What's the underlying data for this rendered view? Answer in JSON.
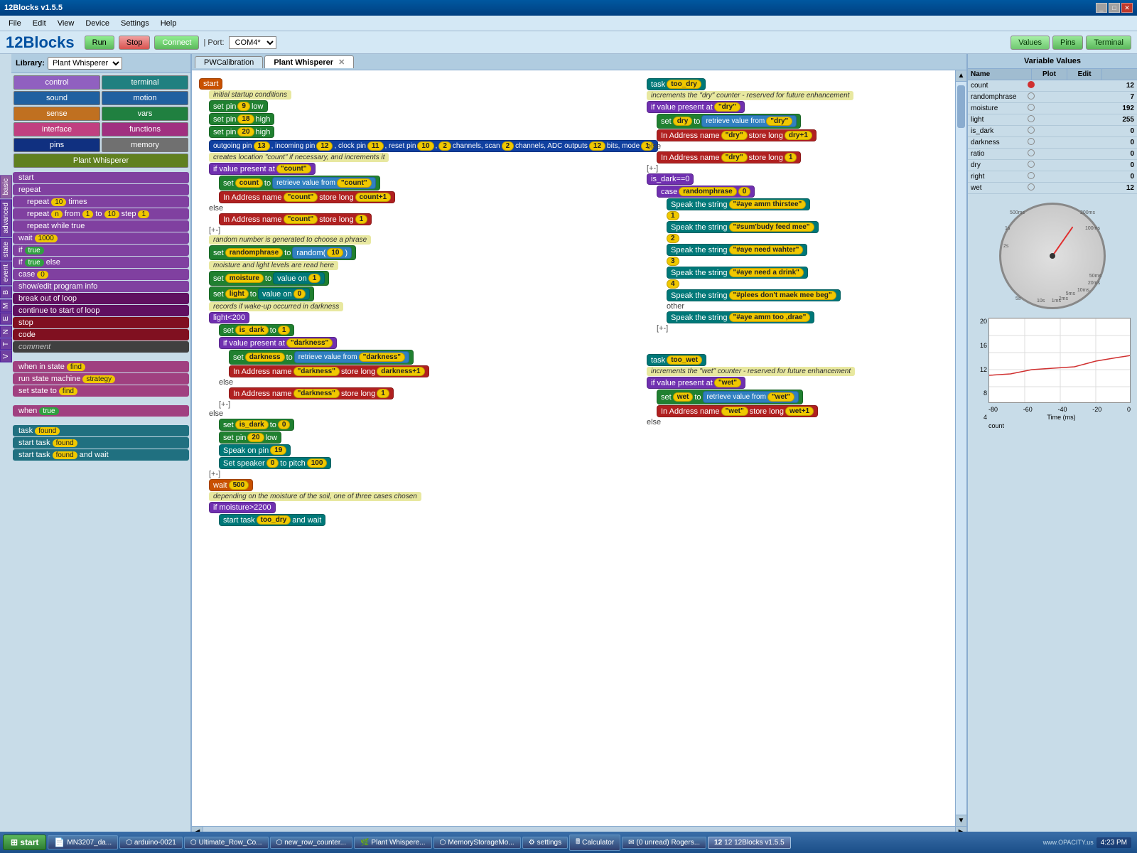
{
  "window": {
    "title": "12Blocks v1.5.5",
    "titlebar_icon": "12"
  },
  "menubar": {
    "items": [
      "File",
      "Edit",
      "View",
      "Device",
      "Settings",
      "Help"
    ]
  },
  "toolbar": {
    "app_title": "12Blocks",
    "run_label": "Run",
    "stop_label": "Stop",
    "connect_label": "Connect",
    "port_label": "| Port:",
    "port_value": "COM4*",
    "right_tabs": [
      "Values",
      "Pins",
      "Terminal"
    ]
  },
  "library": {
    "label": "Library:",
    "selected": "Plant Whisperer",
    "categories": [
      {
        "label": "control",
        "style": "purple"
      },
      {
        "label": "terminal",
        "style": "teal"
      },
      {
        "label": "sound",
        "style": "blue"
      },
      {
        "label": "motion",
        "style": "blue"
      },
      {
        "label": "sense",
        "style": "orange"
      },
      {
        "label": "vars",
        "style": "green"
      },
      {
        "label": "interface",
        "style": "pink"
      },
      {
        "label": "functions",
        "style": "magenta"
      },
      {
        "label": "pins",
        "style": "darkblue"
      },
      {
        "label": "memory",
        "style": "gray"
      },
      {
        "label": "Plant Whisperer",
        "style": "yellow-green"
      }
    ],
    "side_tabs": [
      "basic",
      "advanced",
      "state",
      "event",
      "B",
      "M",
      "E",
      "N",
      "T",
      "V"
    ],
    "blocks": [
      "start",
      "repeat",
      "repeat 10 times",
      "repeat n from 1 to 10 step 1",
      "repeat while true",
      "wait 1000",
      "if true",
      "if true else",
      "case 0",
      "show/edit program info",
      "break out of loop",
      "continue to start of loop",
      "stop",
      "code",
      "comment"
    ]
  },
  "canvas": {
    "tabs": [
      {
        "label": "PWCalibration",
        "active": false
      },
      {
        "label": "Plant Whisperer",
        "active": true,
        "closable": true
      }
    ],
    "blocks": []
  },
  "variables": {
    "title": "Variable Values",
    "tabs": [
      "Name",
      "Plot",
      "Edit"
    ],
    "rows": [
      {
        "name": "count",
        "plot": true,
        "value": "12"
      },
      {
        "name": "randomphrase",
        "plot": false,
        "value": "7"
      },
      {
        "name": "moisture",
        "plot": true,
        "value": "192"
      },
      {
        "name": "light",
        "plot": false,
        "value": "255"
      },
      {
        "name": "is_dark",
        "plot": false,
        "value": "0"
      },
      {
        "name": "darkness",
        "plot": false,
        "value": "0"
      },
      {
        "name": "ratio",
        "plot": false,
        "value": "0"
      },
      {
        "name": "dry",
        "plot": false,
        "value": "0"
      },
      {
        "name": "right",
        "plot": false,
        "value": "0"
      },
      {
        "name": "wet",
        "plot": false,
        "value": "12"
      }
    ],
    "chart": {
      "y_labels": [
        "20",
        "16",
        "12",
        "8",
        "4"
      ],
      "x_label": "count",
      "x_axis_label": "Time (ms)",
      "x_values": [
        "-80",
        "-60",
        "-40",
        "-20",
        "0"
      ]
    }
  },
  "taskbar": {
    "start_label": "start",
    "items": [
      {
        "label": "MN3207_da...",
        "icon": "pdf"
      },
      {
        "label": "arduino-0021",
        "icon": "app"
      },
      {
        "label": "Ultimate_Row_Co...",
        "icon": "app"
      },
      {
        "label": "new_row_counter...",
        "icon": "app"
      },
      {
        "label": "Plant Whisperer",
        "icon": "flower"
      },
      {
        "label": "MemoryStorageMo...",
        "icon": "app"
      },
      {
        "label": "settings",
        "icon": "gear"
      },
      {
        "label": "Calculator",
        "icon": "calc"
      },
      {
        "label": "(0 unread) Rogers...",
        "icon": "mail"
      },
      {
        "label": "12 12Blocks v1.5.5",
        "icon": "12",
        "active": true
      }
    ],
    "time": "4:23 PM",
    "watermark": "www.OPACITY.us"
  }
}
